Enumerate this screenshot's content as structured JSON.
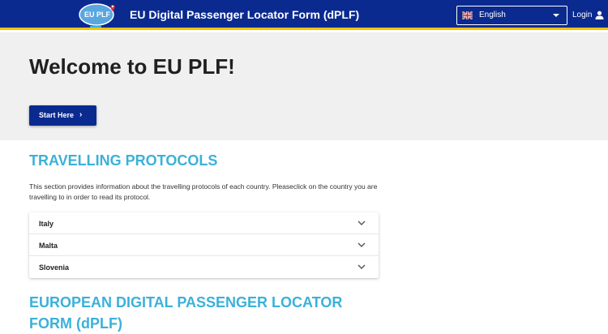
{
  "header": {
    "logo_text": "EU PLF",
    "title": "EU Digital Passenger Locator Form (dPLF)",
    "language": "English",
    "login_label": "Login"
  },
  "hero": {
    "title": "Welcome to EU PLF!",
    "start_label": "Start Here",
    "start_chevron": "›"
  },
  "protocols": {
    "title": "TRAVELLING PROTOCOLS",
    "description": "This section provides information about the travelling protocols of each country. Pleaseclick on the country you are travelling to in order to read its protocol.",
    "countries": [
      "Italy",
      "Malta",
      "Slovenia"
    ]
  },
  "dplf_section": {
    "title": "EUROPEAN DIGITAL PASSENGER LOCATOR FORM (dPLF)"
  },
  "colors": {
    "brand_blue": "#0a2a8f",
    "accent_yellow": "#f2c300",
    "section_title": "#3bb1d9"
  }
}
